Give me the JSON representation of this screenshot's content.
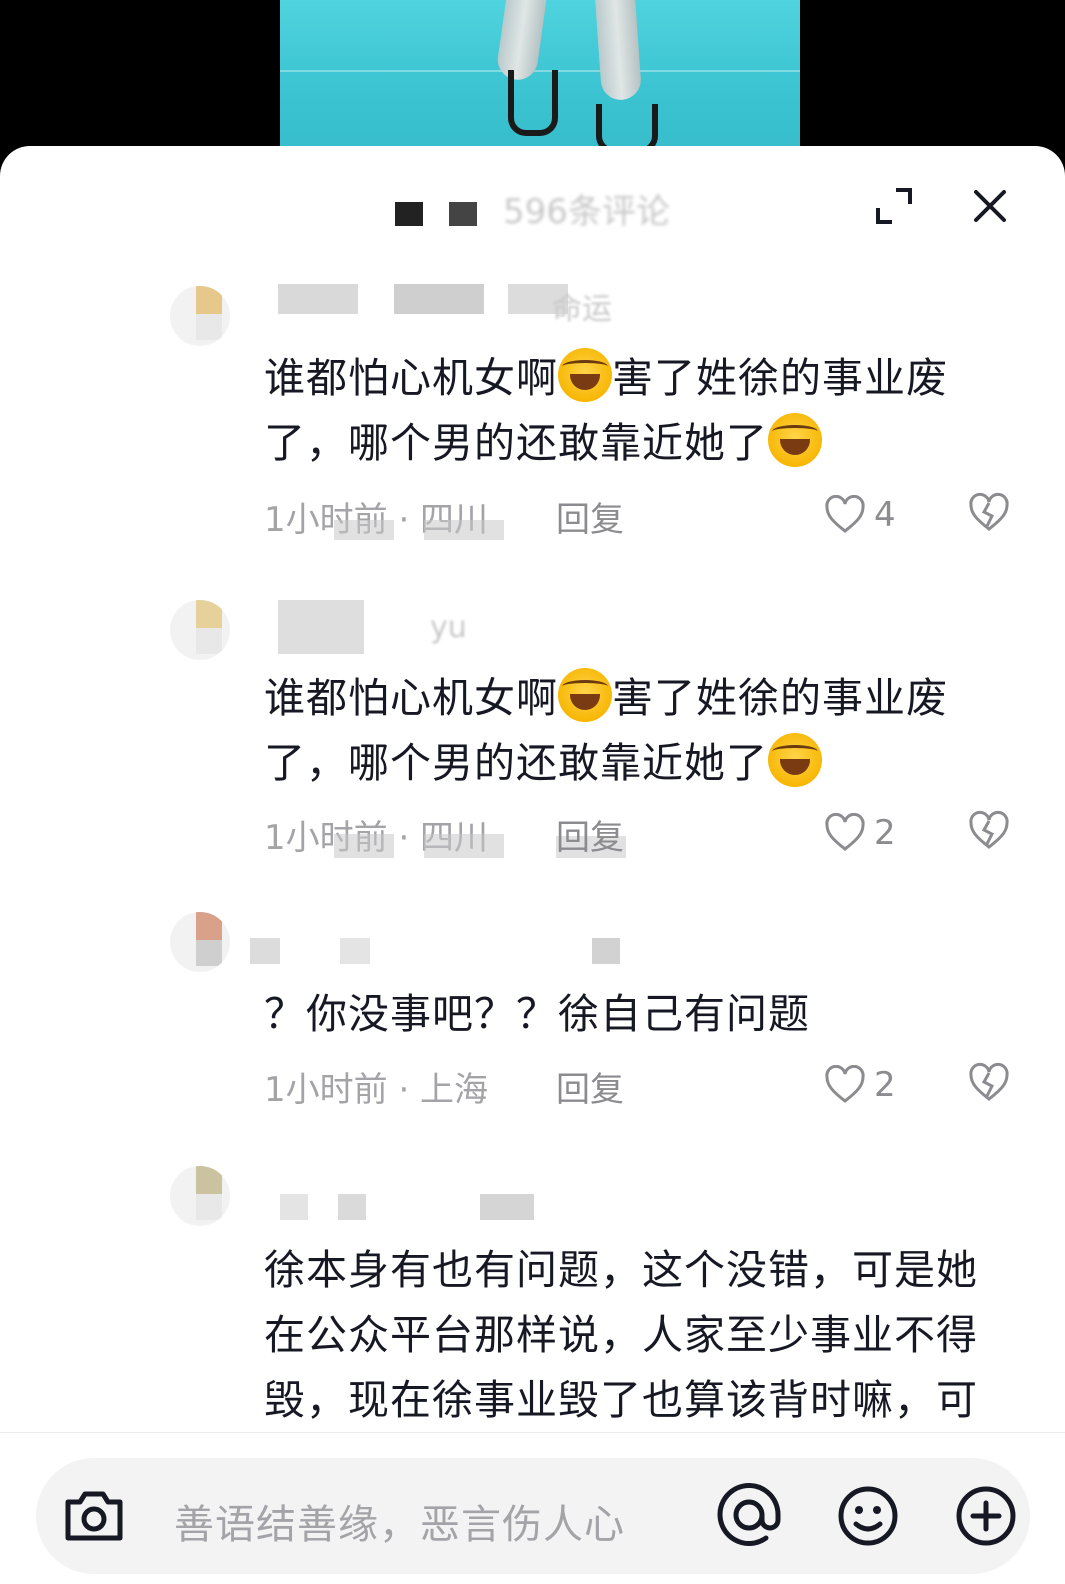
{
  "header": {
    "comment_count_label": "596条评论"
  },
  "comments": [
    {
      "username": "命运",
      "text_a": "谁都怕心机女啊",
      "text_b": "害了姓徐的事业废",
      "text_c": "了，哪个男的还敢靠近她了",
      "time_location": "1小时前 · 四川",
      "reply": "回复",
      "likes": "4"
    },
    {
      "username": "yu",
      "text_a": "谁都怕心机女啊",
      "text_b": "害了姓徐的事业废",
      "text_c": "了，哪个男的还敢靠近她了",
      "time_location": "1小时前 · 四川",
      "reply": "回复",
      "likes": "2"
    },
    {
      "username": "",
      "text": "？你没事吧？？徐自己有问题",
      "time_location": "1小时前 · 上海",
      "reply": "回复",
      "likes": "2"
    },
    {
      "username": "",
      "line1": "徐本身有也有问题，这个没错，可是她",
      "line2": "在公众平台那样说，人家至少事业不得",
      "line3": "毁，现在徐事业毁了也算该背时嘛，可"
    }
  ],
  "input": {
    "placeholder": "善语结善缘，恶言伤人心"
  },
  "icons": {
    "expand": "expand-icon",
    "close": "close-icon",
    "like": "heart-icon",
    "dislike": "broken-heart-icon",
    "camera": "camera-icon",
    "mention": "at-icon",
    "emoji": "emoji-icon",
    "add": "plus-circle-icon"
  },
  "colors": {
    "sheet_bg": "#ffffff",
    "text": "#161823",
    "meta": "#a3a3a8",
    "video_bg": "#3cc4d2"
  }
}
